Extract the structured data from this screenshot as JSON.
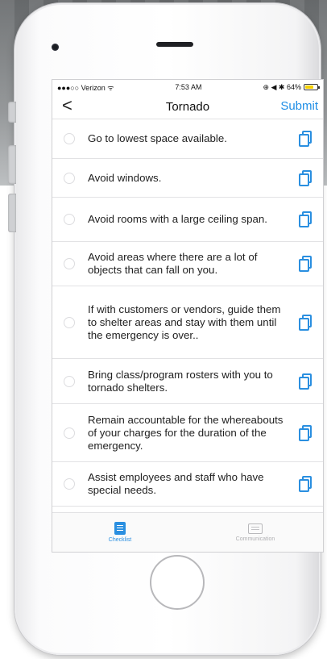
{
  "status_bar": {
    "carrier": "●●●○○ Verizon ᯤ",
    "time": "7:53 AM",
    "indicators": "⊕ ◀ ✱ 64%",
    "battery_level_percent": 64
  },
  "nav": {
    "back_glyph": "<",
    "title": "Tornado",
    "submit_label": "Submit"
  },
  "checklist": {
    "items": [
      {
        "text": "Go to lowest space available.",
        "checked": false
      },
      {
        "text": "Avoid windows.",
        "checked": false
      },
      {
        "text": "Avoid rooms with a large ceiling span.",
        "checked": false
      },
      {
        "text": "Avoid areas where there are a lot of objects that can fall on you.",
        "checked": false
      },
      {
        "text": "If with customers or vendors, guide them to shelter areas and stay with them until the emergency is over..",
        "checked": false
      },
      {
        "text": "Bring class/program rosters with you to tornado shelters.",
        "checked": false
      },
      {
        "text": "Remain accountable for the whereabouts of your charges for the duration of the emergency.",
        "checked": false
      },
      {
        "text": "Assist employees and staff who have special needs.",
        "checked": false
      }
    ]
  },
  "tabs": [
    {
      "label": "Checklist",
      "active": true
    },
    {
      "label": "Communication",
      "active": false
    }
  ],
  "colors": {
    "accent": "#1f8ee6",
    "text": "#222222",
    "divider": "#e2e2e4"
  }
}
